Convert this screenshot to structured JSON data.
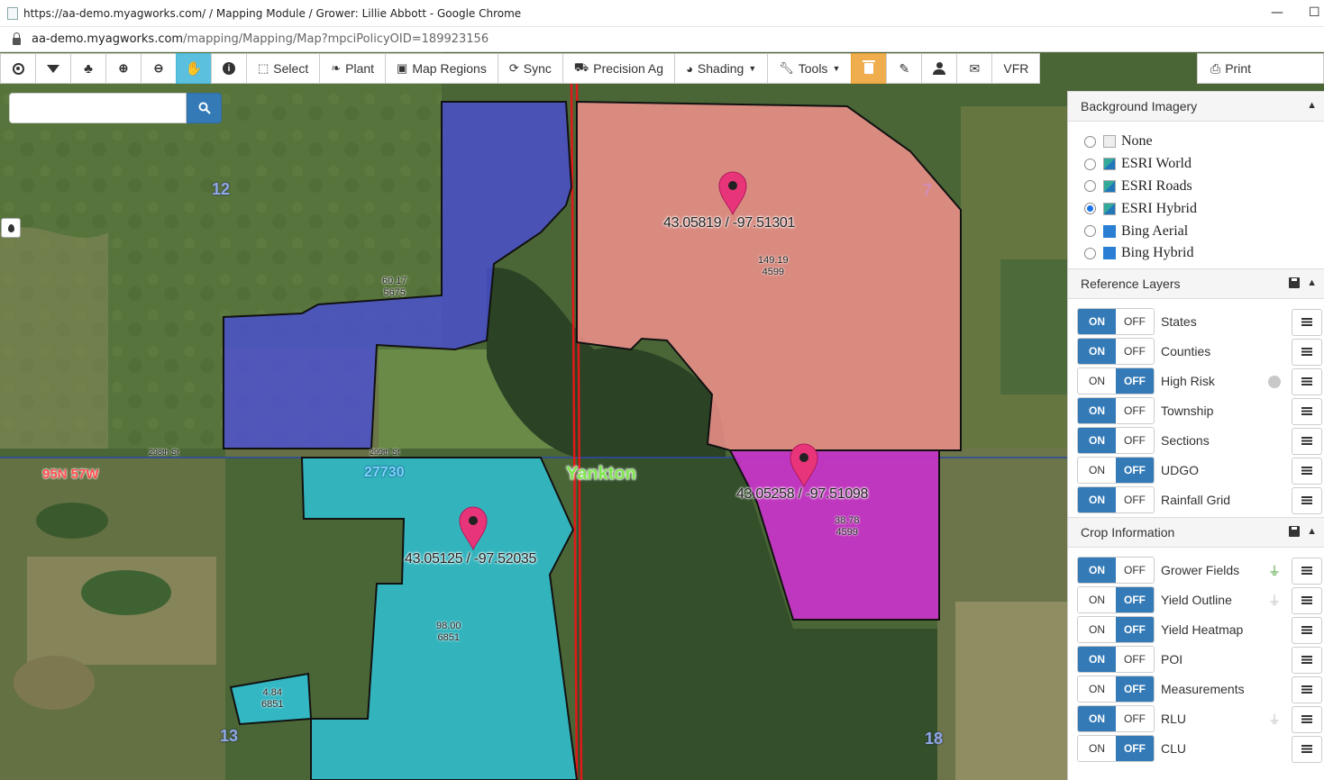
{
  "window": {
    "title": "https://aa-demo.myagworks.com/ / Mapping Module / Grower: Lillie Abbott - Google Chrome",
    "minimize": "—",
    "maximize": "☐"
  },
  "address": {
    "host": "aa-demo.myagworks.com",
    "path": "/mapping/Mapping/Map?mpciPolicyOID=189923156"
  },
  "toolbar": {
    "select_label": "Select",
    "plant_label": "Plant",
    "map_regions_label": "Map Regions",
    "sync_label": "Sync",
    "precision_ag_label": "Precision Ag",
    "shading_label": "Shading",
    "tools_label": "Tools",
    "vfr_label": "VFR",
    "print_label": "Print"
  },
  "search": {
    "placeholder": "",
    "value": ""
  },
  "map": {
    "markers": [
      {
        "label": "43.05819 / -97.51301"
      },
      {
        "label": "43.05258 / -97.51098"
      },
      {
        "label": "43.05125 / -97.52035"
      }
    ],
    "fields": [
      {
        "acres": "60.17",
        "id": "5675"
      },
      {
        "acres": "149.19",
        "id": "4599"
      },
      {
        "acres": "38.78",
        "id": "4599"
      },
      {
        "acres": "98.00",
        "id": "6851"
      },
      {
        "acres": "4.84",
        "id": "6851"
      }
    ],
    "sections": [
      "12",
      "7",
      "13",
      "18"
    ],
    "township": "95N 57W",
    "county_code": "27730",
    "city": "Yankton",
    "roads": [
      "298th St",
      "299th St"
    ]
  },
  "panel": {
    "background_imagery": {
      "title": "Background Imagery",
      "options": [
        "None",
        "ESRI World",
        "ESRI Roads",
        "ESRI Hybrid",
        "Bing Aerial",
        "Bing Hybrid"
      ],
      "selected": "ESRI Hybrid"
    },
    "reference_layers": {
      "title": "Reference Layers",
      "layers": [
        {
          "name": "States",
          "state": "ON"
        },
        {
          "name": "Counties",
          "state": "ON"
        },
        {
          "name": "High Risk",
          "state": "OFF"
        },
        {
          "name": "Township",
          "state": "ON"
        },
        {
          "name": "Sections",
          "state": "ON"
        },
        {
          "name": "UDGO",
          "state": "OFF"
        },
        {
          "name": "Rainfall Grid",
          "state": "ON"
        }
      ]
    },
    "crop_information": {
      "title": "Crop Information",
      "layers": [
        {
          "name": "Grower Fields",
          "state": "ON"
        },
        {
          "name": "Yield Outline",
          "state": "OFF"
        },
        {
          "name": "Yield Heatmap",
          "state": "OFF"
        },
        {
          "name": "POI",
          "state": "ON"
        },
        {
          "name": "Measurements",
          "state": "OFF"
        },
        {
          "name": "RLU",
          "state": "ON"
        },
        {
          "name": "CLU",
          "state": "OFF"
        }
      ]
    },
    "on_label": "ON",
    "off_label": "OFF"
  },
  "colors": {
    "primary": "#337ab7",
    "active_tool": "#5bc0de",
    "delete_tool": "#f0ad4e",
    "field_blue": "#4a4fd6",
    "field_salmon": "#f2928d",
    "field_magenta": "#d42fd6",
    "field_cyan": "#2ec6dc",
    "marker": "#e8357a",
    "county_line": "#e01919"
  }
}
